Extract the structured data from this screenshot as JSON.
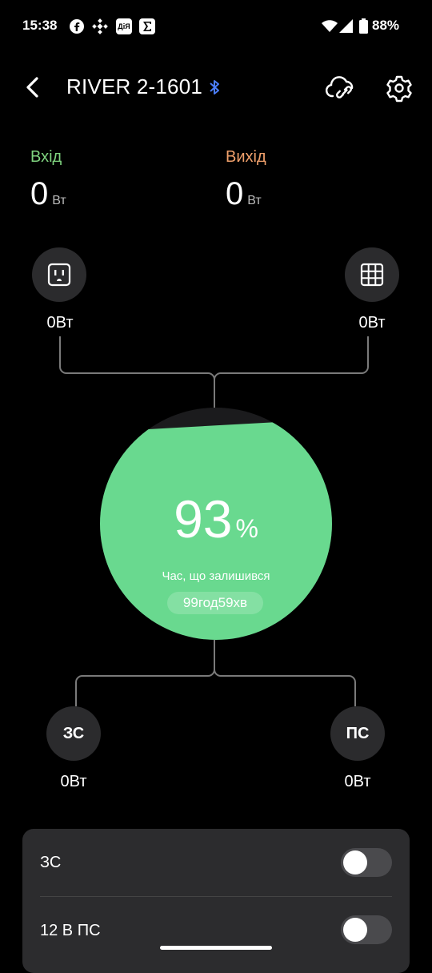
{
  "status_bar": {
    "time": "15:38",
    "app_box_text": "ДіЯ",
    "battery_text": "88%"
  },
  "header": {
    "title": "RIVER 2-1601"
  },
  "io": {
    "input_label": "Вхід",
    "input_value": "0",
    "input_unit": "Вт",
    "output_label": "Вихід",
    "output_value": "0",
    "output_unit": "Вт"
  },
  "ports": {
    "ac_in_value": "0Вт",
    "solar_in_value": "0Вт",
    "ac_out_label": "ЗС",
    "ac_out_value": "0Вт",
    "dc_out_label": "ПС",
    "dc_out_value": "0Вт"
  },
  "battery": {
    "percent": "93",
    "percent_sign": "%",
    "level": 0.93,
    "remaining_label": "Час, що залишився",
    "remaining_value": "99год59хв",
    "color": "#69d98f"
  },
  "panel": {
    "rows": [
      {
        "label": "ЗС",
        "on": false
      },
      {
        "label": "12 В ПС",
        "on": false
      }
    ]
  },
  "colors": {
    "input": "#7fd37f",
    "output": "#f0a06b",
    "bluetooth": "#4a7cf7"
  }
}
